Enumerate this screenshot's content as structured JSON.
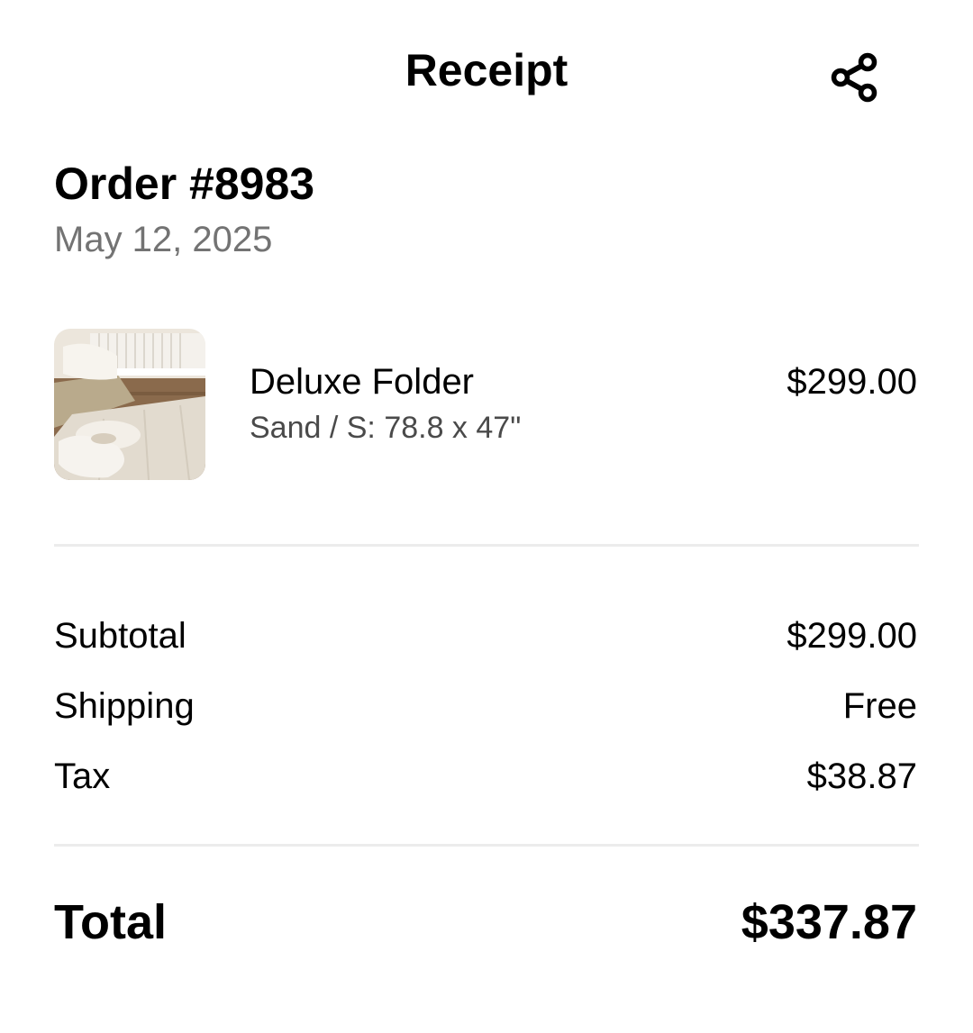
{
  "header": {
    "title": "Receipt",
    "share_icon": "share-icon"
  },
  "order": {
    "number": "Order #8983",
    "date": "May 12, 2025"
  },
  "line_items": [
    {
      "name": "Deluxe Folder",
      "variant": "Sand / S: 78.8 x 47\"",
      "price": "$299.00",
      "thumbnail": "product-photo-play-mat"
    }
  ],
  "summary": {
    "subtotal_label": "Subtotal",
    "subtotal_value": "$299.00",
    "shipping_label": "Shipping",
    "shipping_value": "Free",
    "tax_label": "Tax",
    "tax_value": "$38.87",
    "total_label": "Total",
    "total_value": "$337.87"
  },
  "colors": {
    "text_primary": "#000000",
    "text_secondary": "#737373",
    "divider": "#ececec",
    "background": "#ffffff"
  }
}
